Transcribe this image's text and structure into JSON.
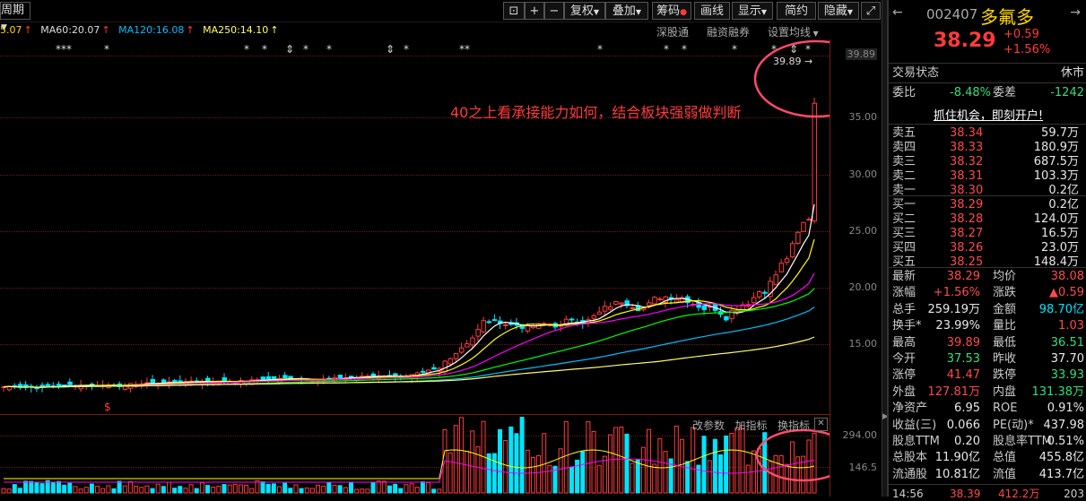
{
  "toolbar": {
    "period": "周期",
    "buttons": [
      "复权",
      "叠加",
      "筹码",
      "画线",
      "显示",
      "简约",
      "隐藏"
    ]
  },
  "ma": {
    "ma_prev": "5.07",
    "ma60": "MA60:20.07",
    "ma120": "MA120:16.08",
    "ma250": "MA250:14.10"
  },
  "chart_links": [
    "深股通",
    "融资融券",
    "设置均线"
  ],
  "price_axis": [
    "39.89",
    "35.00",
    "30.00",
    "25.00",
    "20.00",
    "15.00"
  ],
  "high_callout": "39.89",
  "annotation": "40之上看承接能力如何，结合板块强弱做判断",
  "sub_links": [
    "改参数",
    "加指标",
    "换指标"
  ],
  "vol_axis": [
    "294.00",
    "146.5"
  ],
  "bottom_marker": "$",
  "stock": {
    "code": "002407",
    "name": "多氟多",
    "price": "38.29",
    "change": "+0.59",
    "pct": "+1.56%"
  },
  "trade_status": {
    "label": "交易状态",
    "value": "休市"
  },
  "ratio": {
    "wb_label": "委比",
    "wb": "-8.48%",
    "wc_label": "委差",
    "wc": "-1242"
  },
  "promo": "抓住机会，即刻开户!",
  "sells": [
    {
      "label": "卖五",
      "price": "38.34",
      "vol": "59.7万"
    },
    {
      "label": "卖四",
      "price": "38.33",
      "vol": "180.9万"
    },
    {
      "label": "卖三",
      "price": "38.32",
      "vol": "687.5万"
    },
    {
      "label": "卖二",
      "price": "38.31",
      "vol": "103.3万"
    },
    {
      "label": "卖一",
      "price": "38.30",
      "vol": "0.2亿"
    }
  ],
  "buys": [
    {
      "label": "买一",
      "price": "38.29",
      "vol": "0.2亿"
    },
    {
      "label": "买二",
      "price": "38.28",
      "vol": "124.0万"
    },
    {
      "label": "买三",
      "price": "38.27",
      "vol": "16.5万"
    },
    {
      "label": "买四",
      "price": "38.26",
      "vol": "23.0万"
    },
    {
      "label": "买五",
      "price": "38.25",
      "vol": "148.4万"
    }
  ],
  "quote": [
    {
      "l1": "最新",
      "v1": "38.29",
      "c1": "red",
      "l2": "均价",
      "v2": "38.08",
      "c2": "red"
    },
    {
      "l1": "涨幅",
      "v1": "+1.56%",
      "c1": "red",
      "l2": "涨跌",
      "v2": "▲0.59",
      "c2": "red"
    },
    {
      "l1": "总手",
      "v1": "259.19万",
      "c1": "wht",
      "l2": "金额",
      "v2": "98.70亿",
      "c2": "cyan"
    },
    {
      "l1": "换手*",
      "v1": "23.99%",
      "c1": "wht",
      "l2": "量比",
      "v2": "1.03",
      "c2": "red"
    },
    {
      "l1": "最高",
      "v1": "39.89",
      "c1": "red",
      "l2": "最低",
      "v2": "36.51",
      "c2": "grn"
    },
    {
      "l1": "今开",
      "v1": "37.53",
      "c1": "grn",
      "l2": "昨收",
      "v2": "37.70",
      "c2": "wht"
    },
    {
      "l1": "涨停",
      "v1": "41.47",
      "c1": "red",
      "l2": "跌停",
      "v2": "33.93",
      "c2": "grn"
    },
    {
      "l1": "外盘",
      "v1": "127.81万",
      "c1": "red",
      "l2": "内盘",
      "v2": "131.38万",
      "c2": "grn"
    },
    {
      "l1": "净资产",
      "v1": "6.95",
      "c1": "wht",
      "l2": "ROE",
      "v2": "0.91%",
      "c2": "wht"
    },
    {
      "l1": "收益(三)",
      "v1": "0.066",
      "c1": "wht",
      "l2": "PE(动)*",
      "v2": "437.98",
      "c2": "wht"
    },
    {
      "l1": "股息TTM",
      "v1": "0.20",
      "c1": "wht",
      "l2": "股息率TTM",
      "v2": "0.51%",
      "c2": "wht"
    },
    {
      "l1": "总股本",
      "v1": "11.90亿",
      "c1": "wht",
      "l2": "总值",
      "v2": "455.8亿",
      "c2": "wht"
    },
    {
      "l1": "流通股",
      "v1": "10.81亿",
      "c1": "wht",
      "l2": "流值",
      "v2": "413.7亿",
      "c2": "wht"
    }
  ],
  "tick": {
    "time": "14:56",
    "price": "38.39",
    "vol": "412.2万",
    "n": "203"
  },
  "colors": {
    "up": "#ff3b3b",
    "down": "#00e5ff",
    "ma5": "#ffffff",
    "ma10": "#ffff00",
    "ma20": "#ff00ff",
    "ma60": "#00ff00",
    "ma120": "#00bfff",
    "ma250": "#ffff66",
    "annot": "#ff3b3b"
  }
}
